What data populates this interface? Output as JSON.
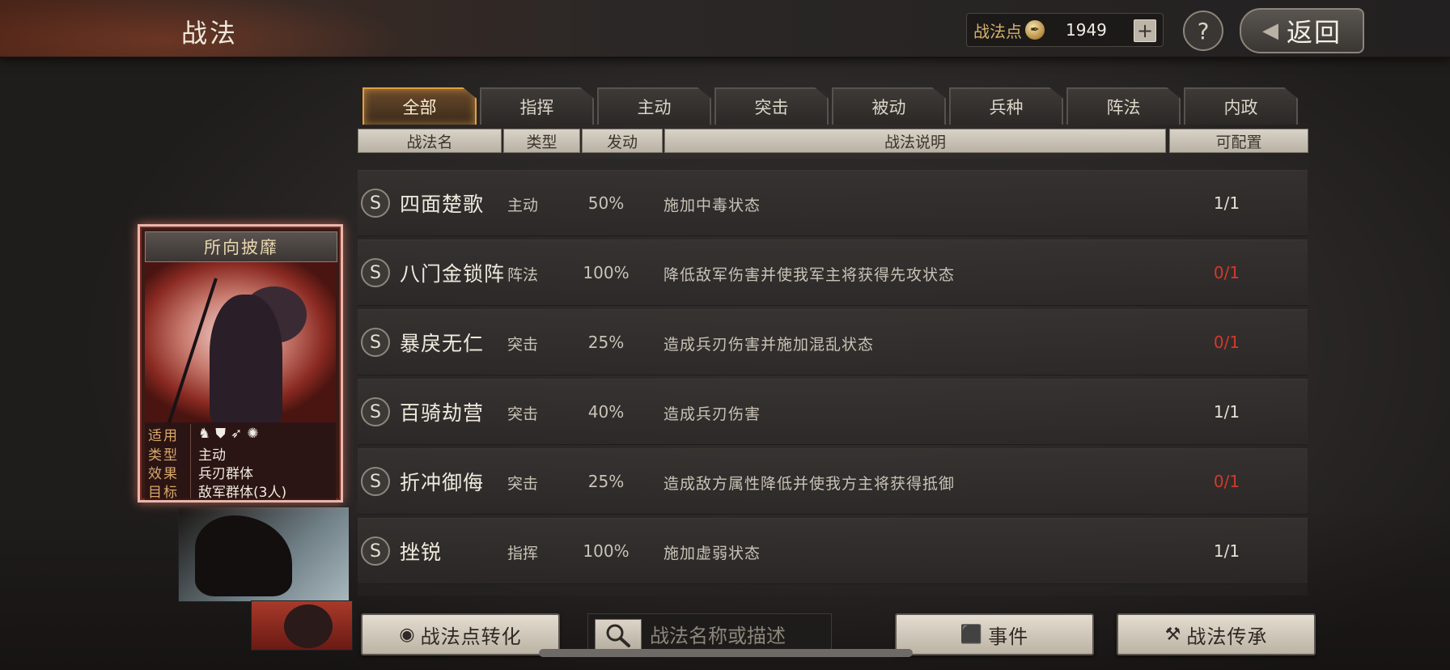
{
  "header": {
    "title": "战法",
    "points_label": "战法点",
    "points_value": "1949",
    "plus_label": "+",
    "help_label": "?",
    "back_label": "返回"
  },
  "tabs": [
    {
      "label": "全部",
      "active": true
    },
    {
      "label": "指挥"
    },
    {
      "label": "主动"
    },
    {
      "label": "突击"
    },
    {
      "label": "被动"
    },
    {
      "label": "兵种"
    },
    {
      "label": "阵法"
    },
    {
      "label": "内政"
    }
  ],
  "columns": {
    "name": "战法名",
    "type": "类型",
    "rate": "发动",
    "desc": "战法说明",
    "avail": "可配置"
  },
  "skills": [
    {
      "badge": "S",
      "name": "四面楚歌",
      "type": "主动",
      "rate": "50%",
      "desc": "施加中毒状态",
      "avail": "1/1",
      "avail_red": false
    },
    {
      "badge": "S",
      "name": "八门金锁阵",
      "type": "阵法",
      "rate": "100%",
      "desc": "降低敌军伤害并使我军主将获得先攻状态",
      "avail": "0/1",
      "avail_red": true
    },
    {
      "badge": "S",
      "name": "暴戾无仁",
      "type": "突击",
      "rate": "25%",
      "desc": "造成兵刃伤害并施加混乱状态",
      "avail": "0/1",
      "avail_red": true
    },
    {
      "badge": "S",
      "name": "百骑劫营",
      "type": "突击",
      "rate": "40%",
      "desc": "造成兵刃伤害",
      "avail": "1/1",
      "avail_red": false
    },
    {
      "badge": "S",
      "name": "折冲御侮",
      "type": "突击",
      "rate": "25%",
      "desc": "造成敌方属性降低并使我方主将获得抵御",
      "avail": "0/1",
      "avail_red": true
    },
    {
      "badge": "S",
      "name": "挫锐",
      "type": "指挥",
      "rate": "100%",
      "desc": "施加虚弱状态",
      "avail": "1/1",
      "avail_red": false
    }
  ],
  "card": {
    "title": "所向披靡",
    "applies_label": "适用",
    "applies_icons": [
      "cavalry-icon",
      "shield-icon",
      "bow-icon",
      "wheel-icon"
    ],
    "type_label": "类型",
    "type_value": "主动",
    "effect_label": "效果",
    "effect_value": "兵刃群体",
    "target_label": "目标",
    "target_value": "敌军群体(3人)"
  },
  "bottom": {
    "convert_label": "战法点转化",
    "search_placeholder": "战法名称或描述",
    "event_label": "事件",
    "inherit_label": "战法传承"
  },
  "colors": {
    "accent_gold": "#e0a040",
    "unavailable_red": "#d23a2a"
  }
}
